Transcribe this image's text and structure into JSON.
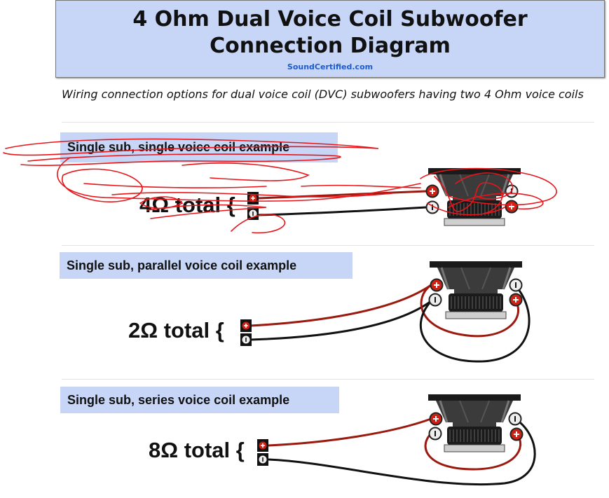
{
  "header": {
    "title": "4 Ohm Dual Voice Coil Subwoofer Connection Diagram",
    "brand": "SoundCertified.com"
  },
  "subtitle": "Wiring connection options for dual voice coil (DVC) subwoofers having two 4 Ohm voice coils",
  "sections": [
    {
      "label": "Single sub, single voice coil example",
      "total": "4Ω total {",
      "wiring": "single"
    },
    {
      "label": "Single sub, parallel voice coil example",
      "total": "2Ω total {",
      "wiring": "parallel"
    },
    {
      "label": "Single sub, series voice coil example",
      "total": "8Ω total {",
      "wiring": "series"
    }
  ],
  "colors": {
    "header_bg": "#c7d6f6",
    "brand": "#1c5ccf",
    "positive_wire": "#9b1a10",
    "negative_wire": "#111111",
    "positive_terminal": "#cc2216",
    "scribble": "#e8151a"
  },
  "icons": [
    "subwoofer-icon",
    "positive-terminal-icon",
    "negative-terminal-icon"
  ]
}
